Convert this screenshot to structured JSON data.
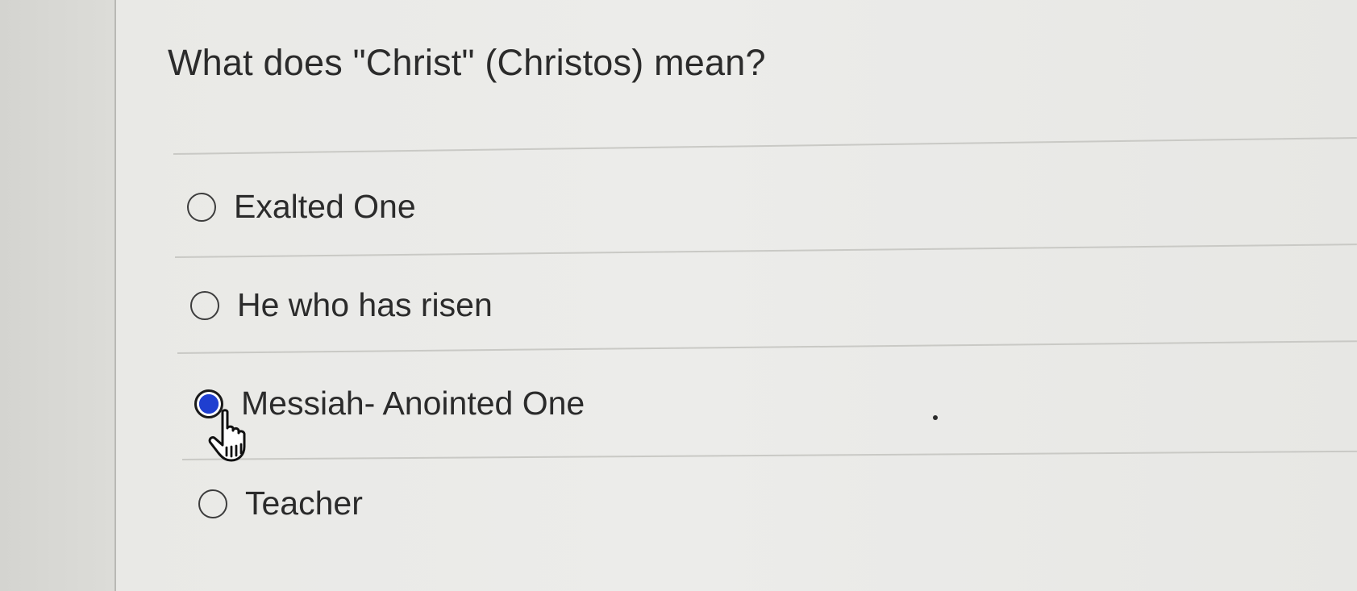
{
  "question": {
    "text": "What does \"Christ\" (Christos) mean?"
  },
  "answers": [
    {
      "label": "Exalted One",
      "selected": false
    },
    {
      "label": "He who has risen",
      "selected": false
    },
    {
      "label": "Messiah- Anointed One",
      "selected": true
    },
    {
      "label": "Teacher",
      "selected": false
    }
  ],
  "colors": {
    "page_background": "#ececea",
    "text": "#2b2b2b",
    "selected_radio": "#1f3fd0"
  },
  "icons": {
    "pointer": "hand-pointer-icon"
  }
}
